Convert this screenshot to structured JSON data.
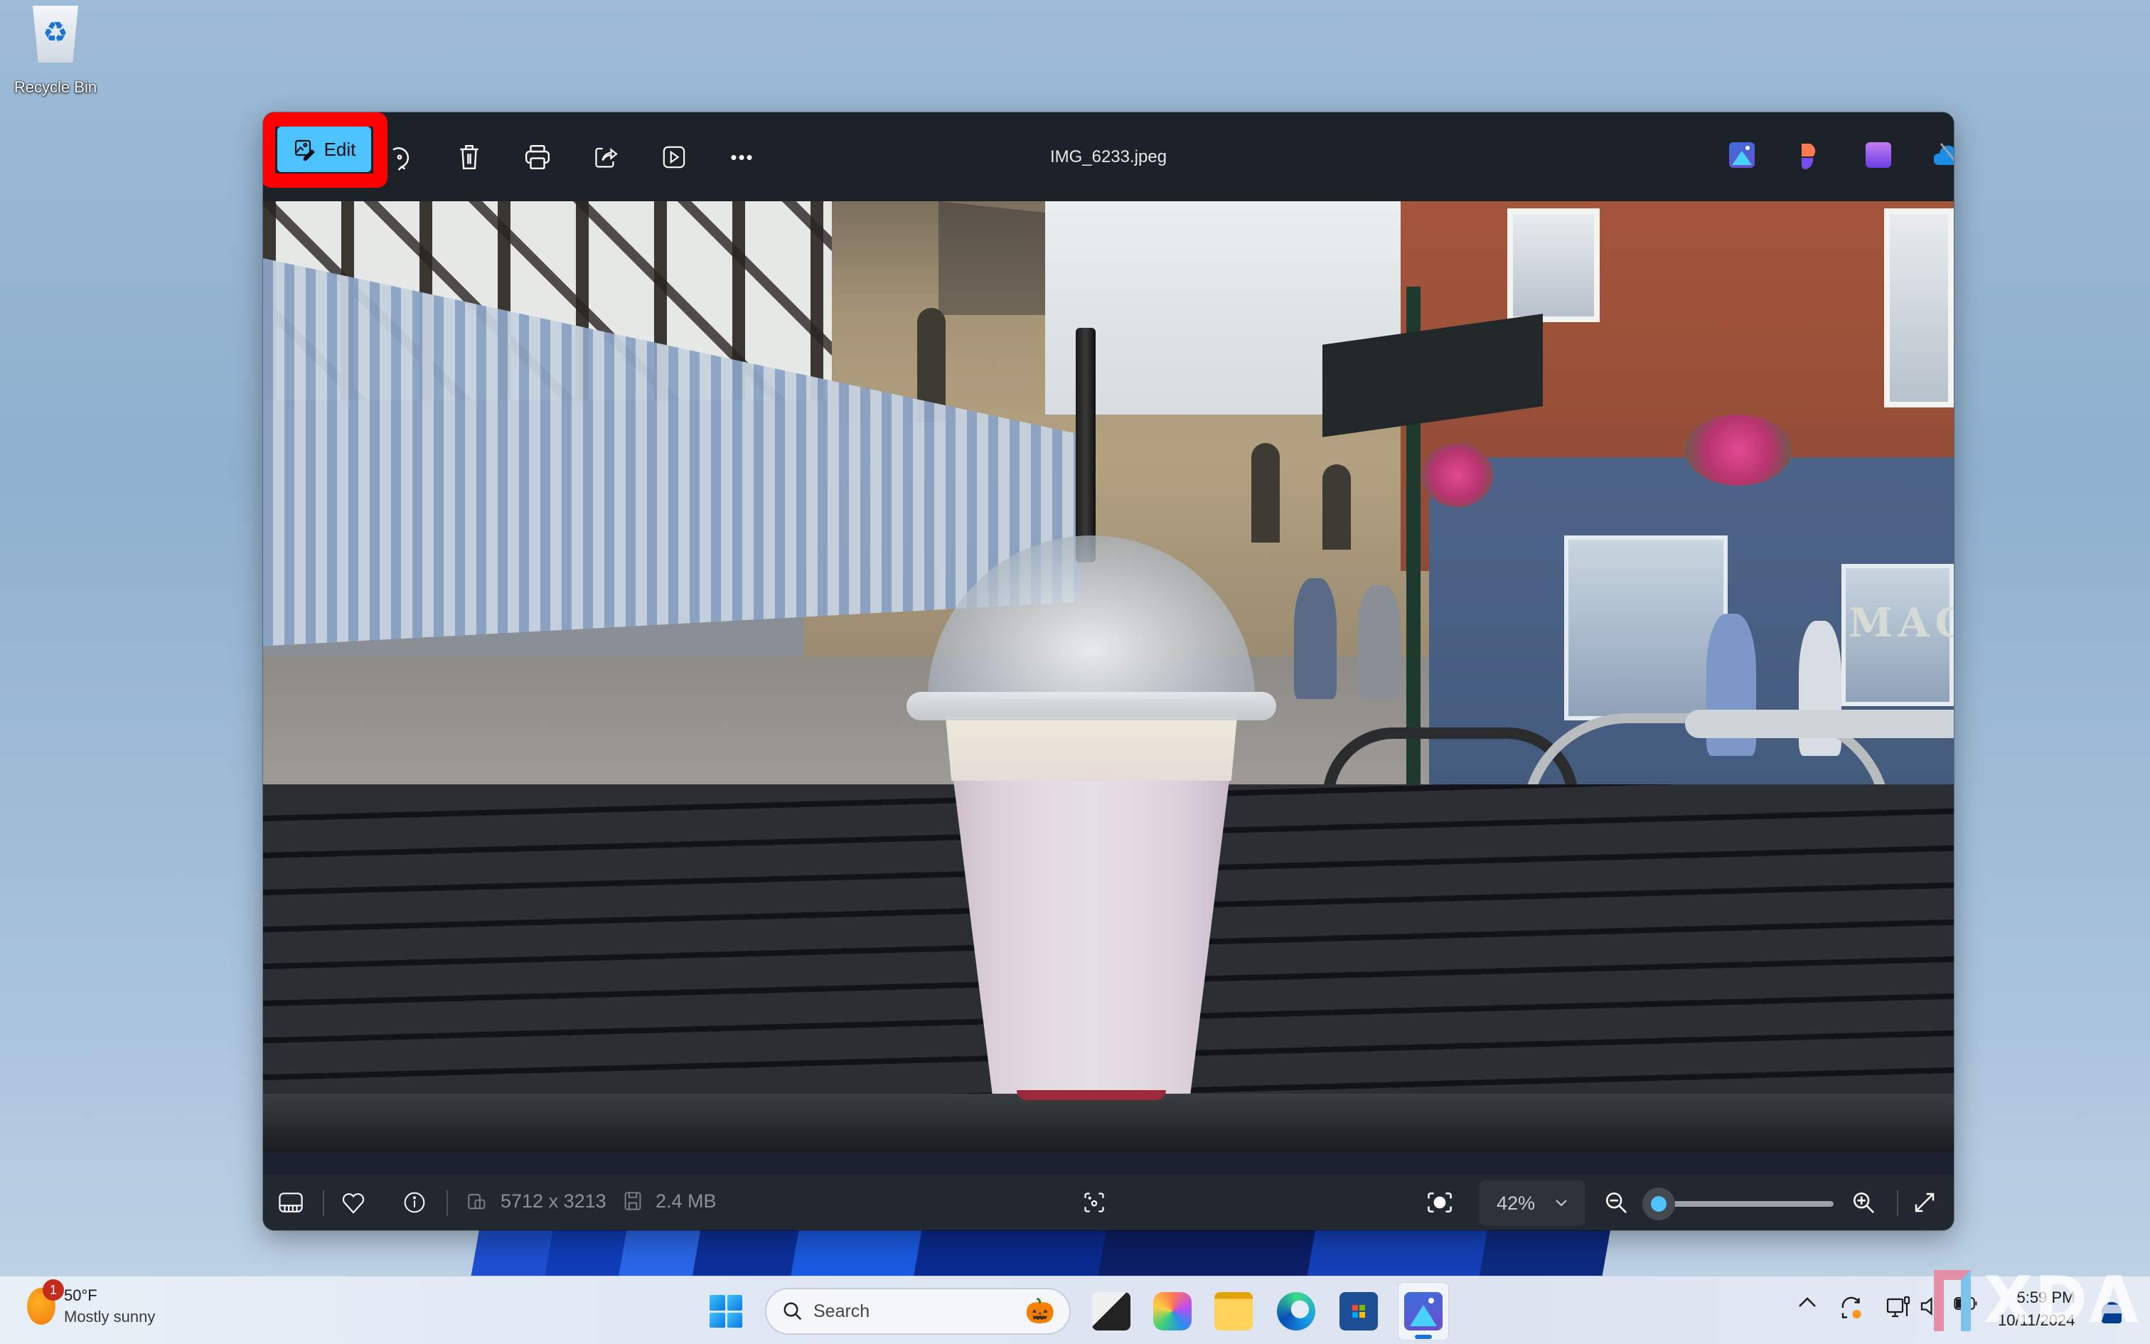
{
  "desktop": {
    "icons": [
      {
        "label": "Recycle Bin",
        "icon": "recycle-bin-icon"
      }
    ]
  },
  "window": {
    "title": "IMG_6233.jpeg",
    "toolbar": {
      "edit_label": "Edit",
      "actions": [
        {
          "name": "rotate",
          "icon": "rotate-icon"
        },
        {
          "name": "delete",
          "icon": "trash-icon"
        },
        {
          "name": "print",
          "icon": "printer-icon"
        },
        {
          "name": "share",
          "icon": "share-icon"
        },
        {
          "name": "slideshow",
          "icon": "play-icon"
        },
        {
          "name": "more",
          "icon": "more-icon",
          "glyph": "•••"
        }
      ],
      "highlight_color": "#ff0000",
      "accent_color": "#4cc2ff"
    },
    "app_icons": [
      {
        "name": "photos",
        "icon": "photos-app-icon"
      },
      {
        "name": "designer",
        "icon": "designer-app-icon"
      },
      {
        "name": "clipchamp",
        "icon": "clipchamp-app-icon"
      },
      {
        "name": "onedrive",
        "icon": "onedrive-offline-icon"
      }
    ],
    "controls": {
      "minimize": "—",
      "maximize": "☐",
      "close": "✕"
    },
    "photo": {
      "description": "Milkshake cup on a dark wooden table in a street scene",
      "sign_text": "MAG"
    },
    "statusbar": {
      "dimensions": "5712 x 3213",
      "file_size": "2.4 MB",
      "zoom_value": "42%",
      "zoom_fraction": 0.06
    }
  },
  "taskbar": {
    "weather": {
      "badge": "1",
      "temp": "50°F",
      "desc": "Mostly sunny"
    },
    "search_placeholder": "Search",
    "apps": [
      {
        "name": "task-view"
      },
      {
        "name": "copilot"
      },
      {
        "name": "file-explorer"
      },
      {
        "name": "edge"
      },
      {
        "name": "microsoft-store"
      },
      {
        "name": "photos",
        "active": true
      }
    ],
    "tray": {
      "chevron": "^",
      "time": "5:59 PM",
      "date": "10/11/2024"
    }
  },
  "watermark": {
    "text": "XDA"
  }
}
